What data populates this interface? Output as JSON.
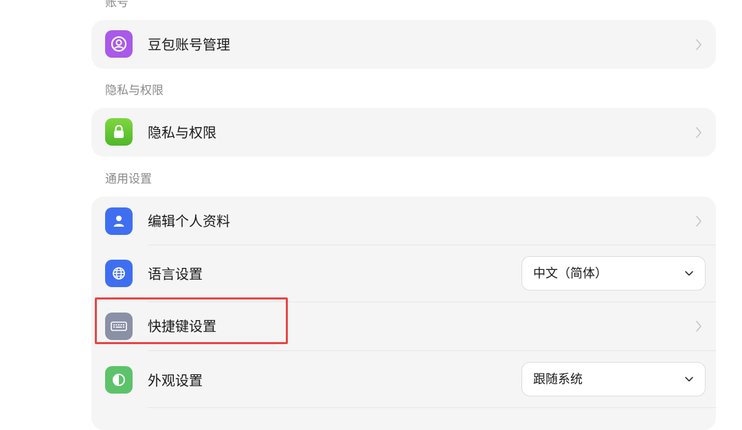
{
  "sections": {
    "account": {
      "label": "账号",
      "items": [
        {
          "title": "豆包账号管理",
          "icon": "user-circle-icon",
          "icon_color": "#a95ae8"
        }
      ]
    },
    "privacy": {
      "label": "隐私与权限",
      "items": [
        {
          "title": "隐私与权限",
          "icon": "lock-icon",
          "icon_color": "#58c332"
        }
      ]
    },
    "general": {
      "label": "通用设置",
      "items": [
        {
          "title": "编辑个人资料",
          "icon": "person-icon",
          "icon_color": "#3f6ff0"
        },
        {
          "title": "语言设置",
          "icon": "globe-icon",
          "icon_color": "#3f6ff0",
          "select_value": "中文（简体）"
        },
        {
          "title": "快捷键设置",
          "icon": "keyboard-icon",
          "icon_color": "#8a90a6"
        },
        {
          "title": "外观设置",
          "icon": "half-circle-icon",
          "icon_color": "#5cc36a",
          "select_value": "跟随系统"
        }
      ]
    }
  },
  "annotation": {
    "highlight_color": "#e84545"
  }
}
